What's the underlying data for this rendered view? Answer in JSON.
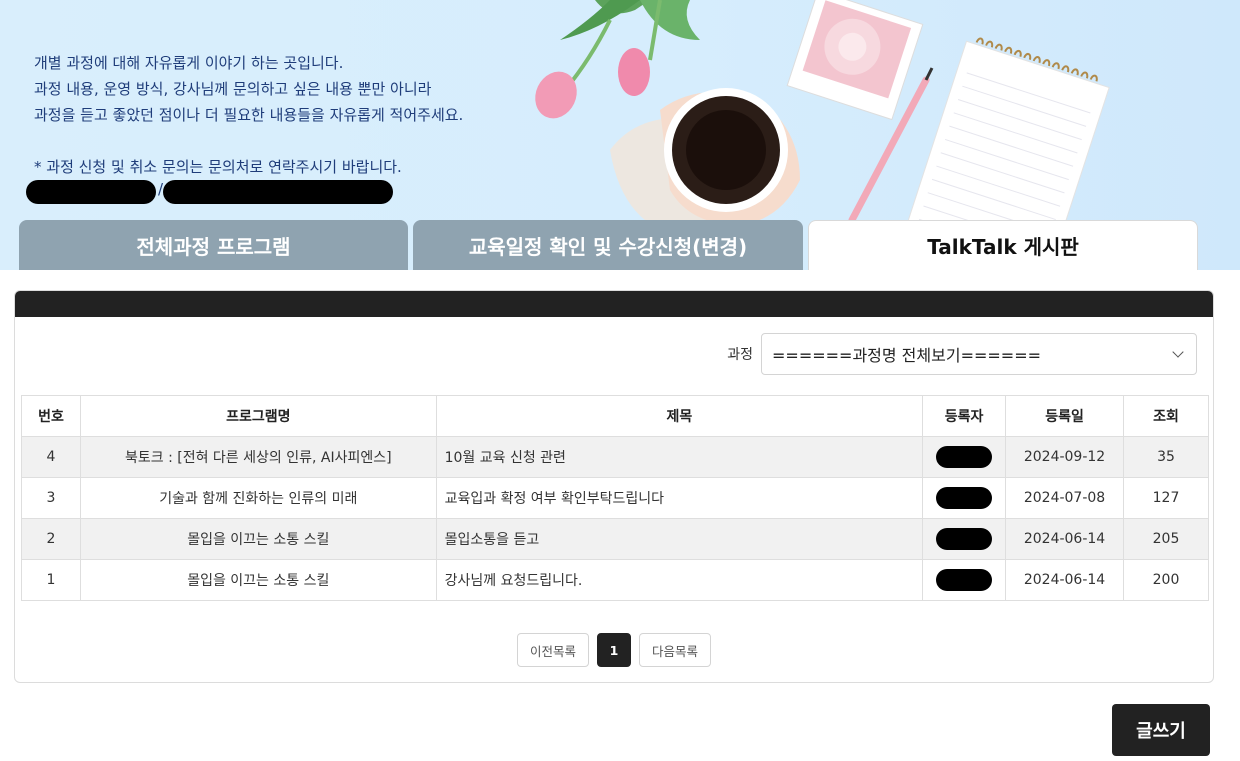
{
  "intro": {
    "line1": "개별 과정에 대해 자유롭게 이야기 하는 곳입니다.",
    "line2": "과정 내용, 운영 방식, 강사님께 문의하고 싶은 내용 뿐만 아니라",
    "line3": "과정을 듣고 좋았던 점이나 더 필요한 내용들을 자유롭게 적어주세요.",
    "notice": "* 과정 신청 및 취소 문의는 문의처로 연락주시기 바랍니다.",
    "contact_separator": "/"
  },
  "tabs": [
    {
      "label": "전체과정 프로그램"
    },
    {
      "label": "교육일정 확인 및 수강신청(변경)"
    },
    {
      "label": "TalkTalk 게시판"
    }
  ],
  "filter": {
    "label": "과정",
    "selected": "======과정명 전체보기======"
  },
  "table": {
    "headers": [
      "번호",
      "프로그램명",
      "제목",
      "등록자",
      "등록일",
      "조회"
    ],
    "rows": [
      {
        "no": "4",
        "program": "북토크 : [전혀 다른 세상의 인류, AI사피엔스]",
        "title": "10월 교육 신청 관련",
        "date": "2024-09-12",
        "views": "35"
      },
      {
        "no": "3",
        "program": "기술과 함께 진화하는 인류의 미래",
        "title": "교육입과 확정 여부 확인부탁드립니다",
        "date": "2024-07-08",
        "views": "127"
      },
      {
        "no": "2",
        "program": "몰입을 이끄는 소통 스킬",
        "title": "몰입소통을 듣고",
        "date": "2024-06-14",
        "views": "205"
      },
      {
        "no": "1",
        "program": "몰입을 이끄는 소통 스킬",
        "title": "강사님께 요청드립니다.",
        "date": "2024-06-14",
        "views": "200"
      }
    ]
  },
  "pager": {
    "prev": "이전목록",
    "current": "1",
    "next": "다음목록"
  },
  "write_button": "글쓰기",
  "colors": {
    "tab_inactive": "#8fa3b0",
    "banner": "#d6edfd",
    "dark": "#222222",
    "intro_text": "#1f3d7a"
  }
}
